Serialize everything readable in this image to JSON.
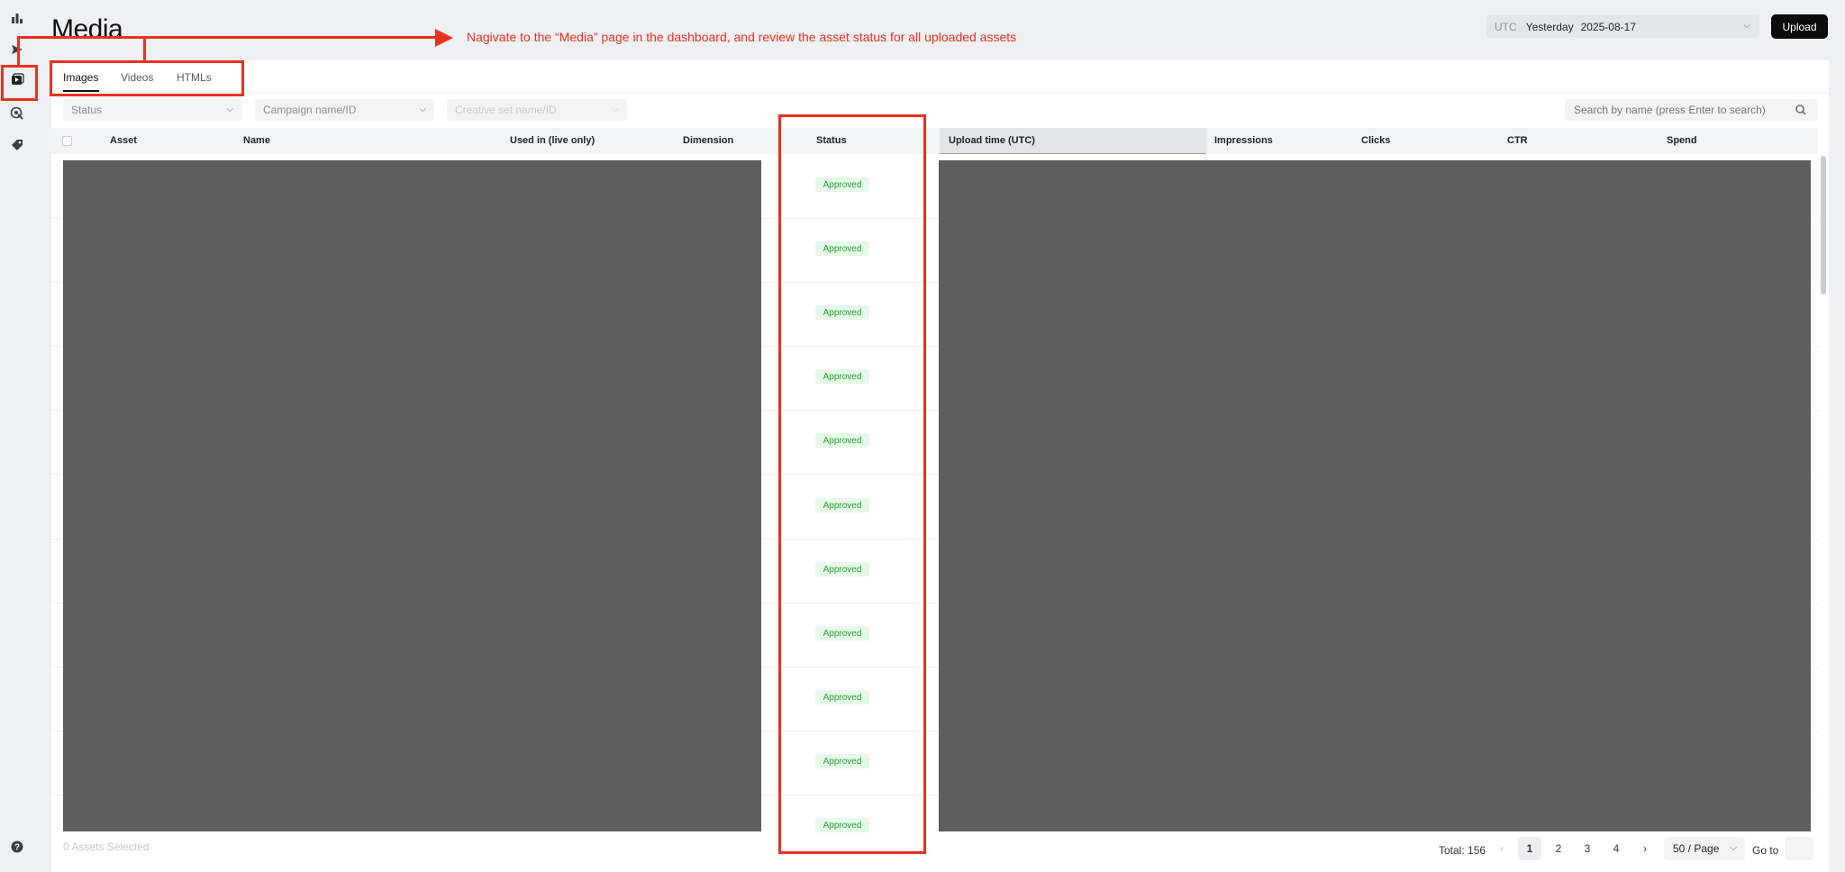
{
  "sidebar": {
    "icons": [
      "bar-chart-icon",
      "send-icon",
      "media-icon",
      "target-icon",
      "tag-icon",
      "help-icon"
    ]
  },
  "header": {
    "title": "Media",
    "timezone": "UTC",
    "date_preset": "Yesterday",
    "date": "2025-08-17",
    "upload_label": "Upload"
  },
  "tabs": [
    "Images",
    "Videos",
    "HTMLs"
  ],
  "filters": {
    "status_placeholder": "Status",
    "campaign_placeholder": "Campaign name/ID",
    "creative_set_placeholder": "Creative set name/ID",
    "search_placeholder": "Search by name (press Enter to search)"
  },
  "table": {
    "columns": [
      "Asset",
      "Name",
      "Used in (live only)",
      "Dimension",
      "Status",
      "Upload time (UTC)",
      "Impressions",
      "Clicks",
      "CTR",
      "Spend"
    ],
    "row_statuses": [
      "Approved",
      "Approved",
      "Approved",
      "Approved",
      "Approved",
      "Approved",
      "Approved",
      "Approved",
      "Approved",
      "Approved",
      "Approved"
    ]
  },
  "footer": {
    "selected": "0 Assets Selected",
    "total": "Total: 156",
    "pages": [
      "1",
      "2",
      "3",
      "4"
    ],
    "current_page": "1",
    "per_page": "50  / Page",
    "goto_label": "Go to"
  },
  "annotation": {
    "text": "Nagivate to the “Media” page in the dashboard, and review the asset status for all uploaded assets",
    "color": "#e8321f"
  },
  "colors": {
    "approved_bg": "#e6f8e8",
    "approved_text": "#21a336",
    "upload_button": "#0b0b0c"
  }
}
